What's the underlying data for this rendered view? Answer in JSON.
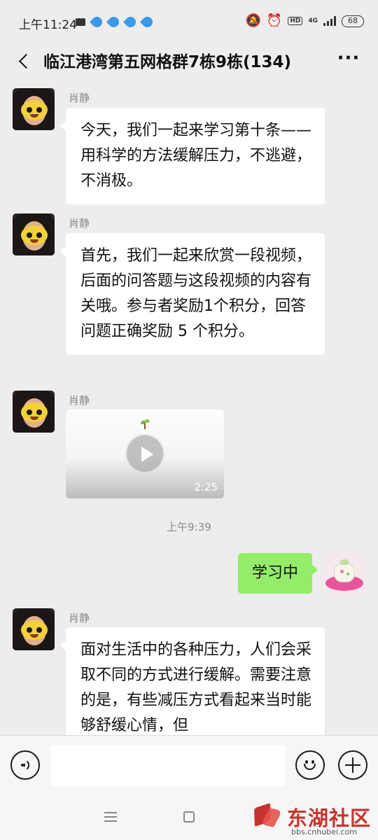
{
  "status_bar": {
    "time": "上午11:24",
    "network_type": "4G",
    "hd_label": "HD",
    "battery": "68"
  },
  "header": {
    "title": "临江港湾第五网格群7栋9栋(134)"
  },
  "messages": [
    {
      "sender": "肖静",
      "text": "今天，我们一起来学习第十条——用科学的方法缓解压力，不逃避，不消极。"
    },
    {
      "sender": "肖静",
      "text": "首先，我们一起来欣赏一段视频，后面的问答题与这段视频的内容有关哦。参与者奖励1个积分，回答问题正确奖励 5 个积分。"
    },
    {
      "sender": "肖静",
      "video_duration": "2:25"
    },
    {
      "timestamp": "上午9:39"
    },
    {
      "self_text": "学习中"
    },
    {
      "sender": "肖静",
      "text": "面对生活中的各种压力，人们会采取不同的方式进行缓解。需要注意的是，有些减压方式看起来当时能够舒缓心情，但"
    }
  ],
  "input_bar": {
    "placeholder": ""
  },
  "watermark": {
    "name": "东湖社区",
    "url": "bbs.cnhubei.com"
  },
  "colors": {
    "background": "#ededed",
    "self_bubble": "#95ec69",
    "other_bubble": "#ffffff",
    "watermark_red": "#c8332e"
  },
  "icons": [
    "back-icon",
    "more-icon",
    "play-icon",
    "voice-icon",
    "emoji-icon",
    "plus-icon",
    "menu-nav-icon",
    "home-nav-icon"
  ]
}
